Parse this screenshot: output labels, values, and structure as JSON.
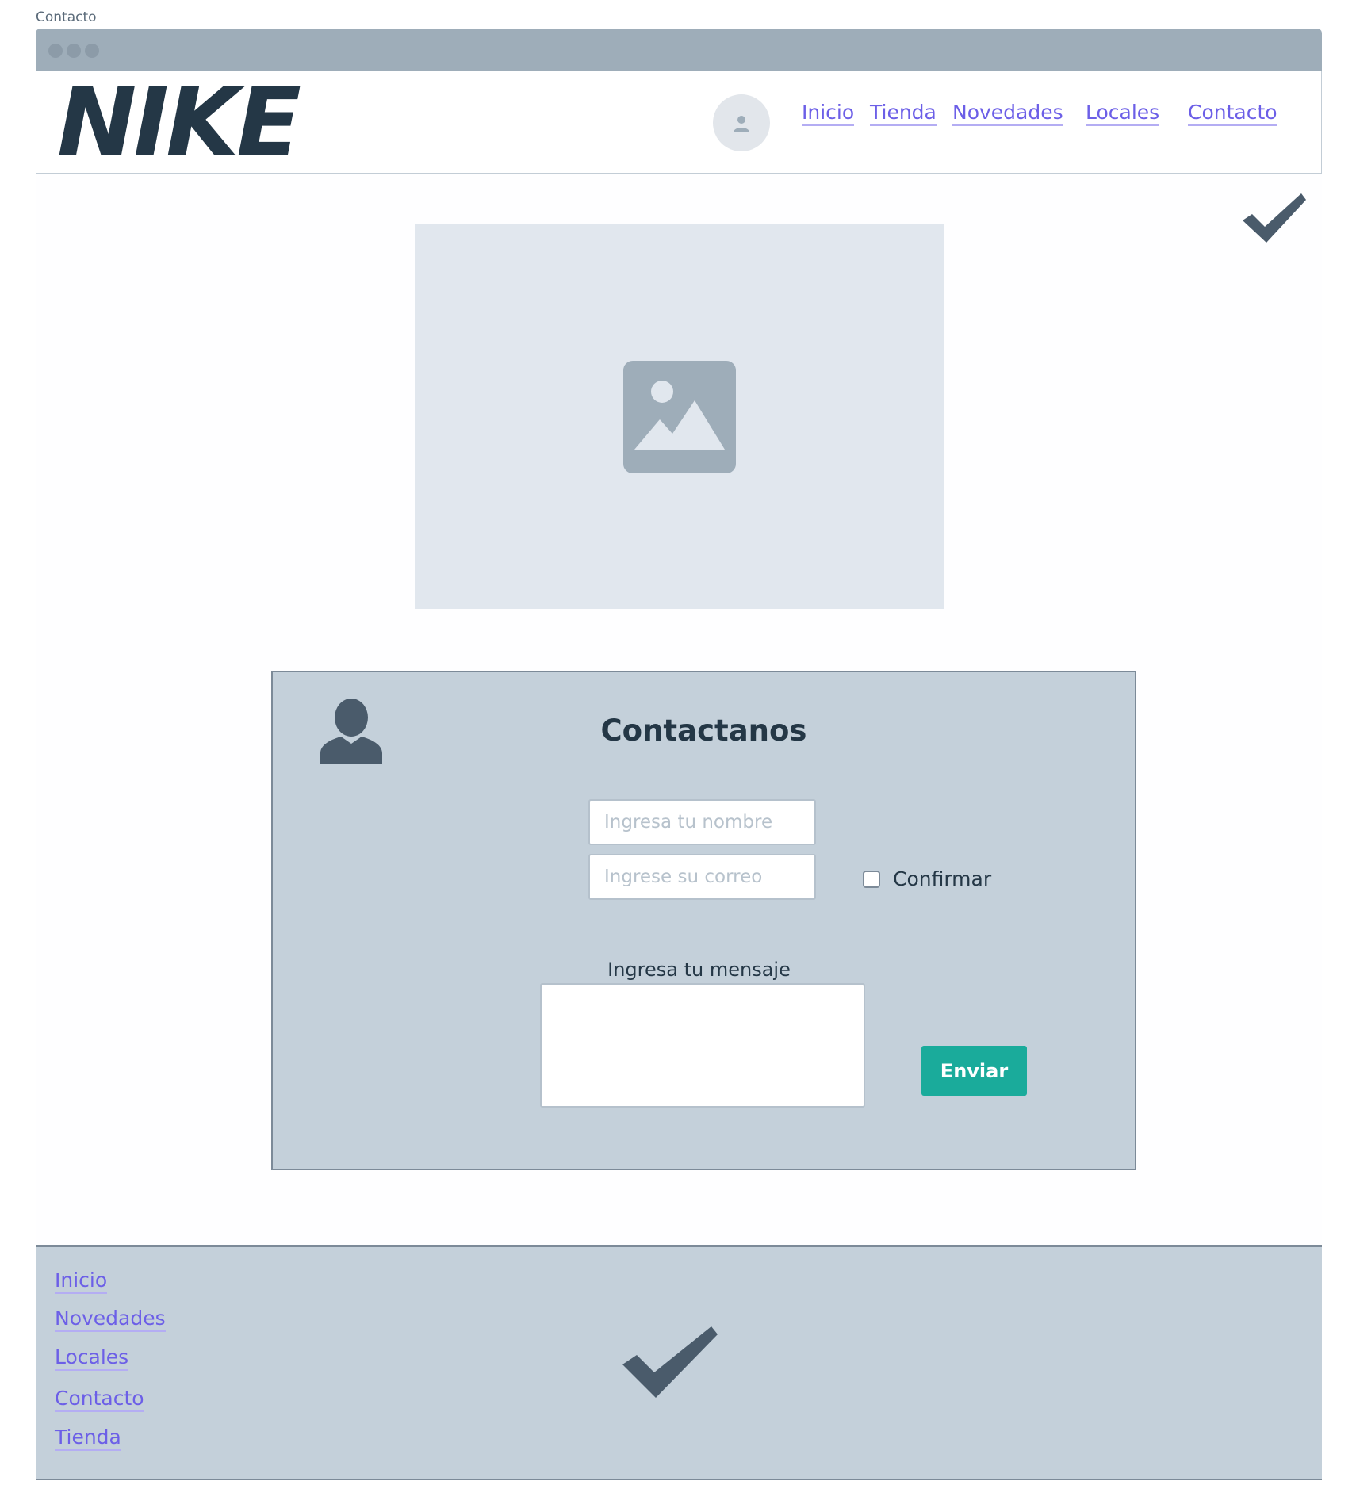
{
  "page": {
    "label": "Contacto"
  },
  "header": {
    "logo": "NIKE",
    "avatar_icon": "user-icon",
    "nav": [
      {
        "label": "Inicio"
      },
      {
        "label": "Tienda"
      },
      {
        "label": "Novedades"
      },
      {
        "label": "Locales"
      },
      {
        "label": "Contacto"
      }
    ]
  },
  "hero": {
    "icon": "image-placeholder-icon"
  },
  "contact": {
    "title": "Contactanos",
    "person_icon": "person-icon",
    "name_placeholder": "Ingresa tu nombre",
    "email_placeholder": "Ingrese su correo",
    "confirm_label": "Confirmar",
    "confirm_checked": false,
    "message_label": "Ingresa tu mensaje",
    "message_value": "",
    "send_label": "Enviar"
  },
  "footer": {
    "links": [
      {
        "label": "Inicio"
      },
      {
        "label": "Novedades"
      },
      {
        "label": "Locales"
      },
      {
        "label": "Contacto"
      },
      {
        "label": "Tienda"
      }
    ],
    "icon": "checkmark-icon"
  },
  "colors": {
    "link": "#6c5fe7",
    "accent_button": "#1aab9b",
    "panel": "#c4d0da",
    "titlebar": "#9eadb9",
    "text_dark": "#243746"
  }
}
